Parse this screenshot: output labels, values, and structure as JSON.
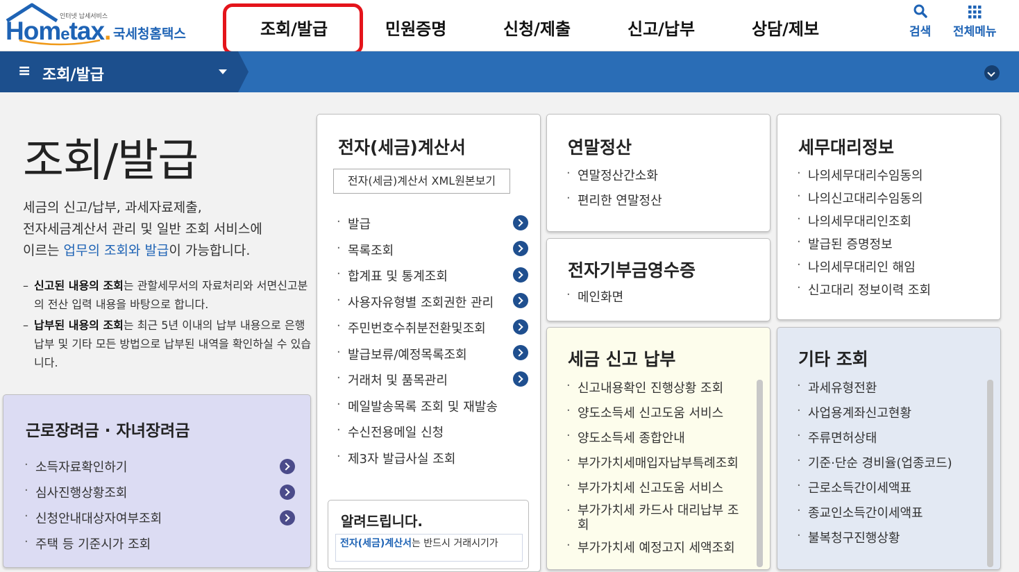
{
  "header": {
    "logo_sub": "인터넷 납세서비스",
    "logo_home": "Hom",
    "logo_e": "e",
    "logo_tax": "tax",
    "logo_dot": ".",
    "logo_kname": "국세청홈택스",
    "nav": [
      "조회/발급",
      "민원증명",
      "신청/제출",
      "신고/납부",
      "상담/제보"
    ],
    "search_label": "검색",
    "allmenu_label": "전체메뉴"
  },
  "subbar": {
    "menu_icon": "≡",
    "title": "조회/발급"
  },
  "intro": {
    "title": "조회/발급",
    "desc_1": "세금의 신고/납부, 과세자료제출,",
    "desc_2": "전자세금계산서 관리 및 일반 조회 서비스에",
    "desc_3_pre": "이르는 ",
    "desc_3_link": "업무의 조회와 발급",
    "desc_3_post": "이 가능합니다.",
    "note1_bold": "신고된 내용의 조회",
    "note1_rest": "는 관할세무서의 자료처리와 서면신고분의 전산 입력 내용을 바탕으로 합니다.",
    "note2_bold": "납부된 내용의 조회",
    "note2_rest": "는 최근 5년 이내의 납부 내용으로 은행 납부 및 기타 모든 방법으로 납부된 내역을 확인하실 수 있습니다."
  },
  "card_subsidy": {
    "title": "근로장려금 · 자녀장려금",
    "items": [
      "소득자료확인하기",
      "심사진행상황조회",
      "신청안내대상자여부조회",
      "주택 등 기준시가 조회"
    ]
  },
  "card_einvoice": {
    "title": "전자(세금)계산서",
    "xml_button": "전자(세금)계산서 XML원본보기",
    "items": [
      "발급",
      "목록조회",
      "합계표 및 통계조회",
      "사용자유형별 조회권한 관리",
      "주민번호수취분전환및조회",
      "발급보류/예정목록조회",
      "거래처 및 품목관리",
      "메일발송목록 조회 및 재발송",
      "수신전용메일 신청",
      "제3자 발급사실 조회"
    ],
    "notice_title": "알려드립니다.",
    "notice_bold": "전자(세금)계산서",
    "notice_text": "는 반드시 거래시기가"
  },
  "card_yearend": {
    "title": "연말정산",
    "items": [
      "연말정산간소화",
      "편리한 연말정산"
    ]
  },
  "card_donation": {
    "title": "전자기부금영수증",
    "items": [
      "메인화면"
    ]
  },
  "card_taxreport": {
    "title": "세금 신고 납부",
    "items": [
      "신고내용확인 진행상황 조회",
      "양도소득세 신고도움 서비스",
      "양도소득세 종합안내",
      "부가가치세매입자납부특례조회",
      "부가가치세 신고도움 서비스",
      "부가가치세 카드사 대리납부 조회",
      "부가가치세 예정고지 세액조회"
    ]
  },
  "card_agent": {
    "title": "세무대리정보",
    "items": [
      "나의세무대리수임동의",
      "나의신고대리수임동의",
      "나의세무대리인조회",
      "발급된 증명정보",
      "나의세무대리인 해임",
      "신고대리 정보이력 조회"
    ]
  },
  "card_other": {
    "title": "기타 조회",
    "items": [
      "과세유형전환",
      "사업용계좌신고현황",
      "주류면허상태",
      "기준·단순 경비율(업종코드)",
      "근로소득간이세액표",
      "종교인소득간이세액표",
      "불복청구진행상황"
    ]
  },
  "colors": {
    "brand_blue": "#1e63b5",
    "subbar_blue": "#2a6db6",
    "highlight_red": "#e4141b",
    "subsidy_bg": "#dcdcf3",
    "taxreport_bg": "#fdfdec",
    "other_bg": "#e3e9f3"
  }
}
